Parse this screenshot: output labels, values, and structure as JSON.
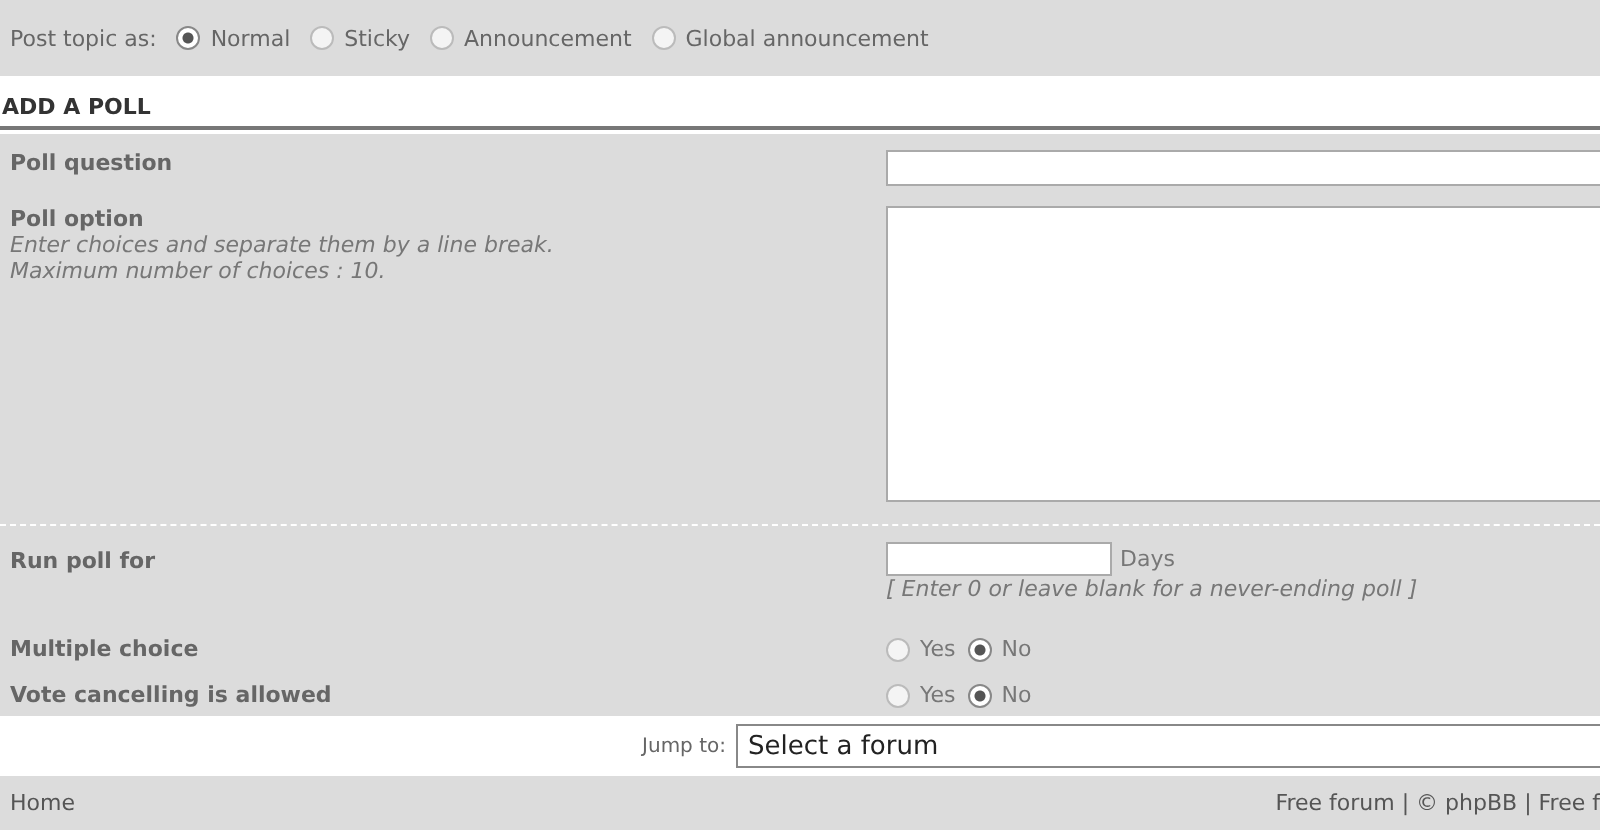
{
  "post_topic": {
    "label": "Post topic as:",
    "options": [
      {
        "label": "Normal",
        "selected": true
      },
      {
        "label": "Sticky",
        "selected": false
      },
      {
        "label": "Announcement",
        "selected": false
      },
      {
        "label": "Global announcement",
        "selected": false
      }
    ]
  },
  "poll": {
    "title": "ADD A POLL",
    "question": {
      "label": "Poll question"
    },
    "option": {
      "label": "Poll option",
      "hint_lines": [
        "Enter choices and separate them by a line break.",
        "Maximum number of choices : 10."
      ]
    },
    "run_for": {
      "label": "Run poll for",
      "unit": "Days",
      "hint": "[ Enter 0 or leave blank for a never-ending poll ]"
    },
    "choices": [
      {
        "label": "Multiple choice",
        "options": [
          {
            "label": "Yes",
            "selected": false
          },
          {
            "label": "No",
            "selected": true
          }
        ]
      },
      {
        "label": "Vote cancelling is allowed",
        "options": [
          {
            "label": "Yes",
            "selected": false
          },
          {
            "label": "No",
            "selected": true
          }
        ]
      }
    ]
  },
  "jump": {
    "label": "Jump to:",
    "value": "Select a forum"
  },
  "footer": {
    "left": "Home",
    "right": "Free forum | © phpBB | Free f"
  }
}
